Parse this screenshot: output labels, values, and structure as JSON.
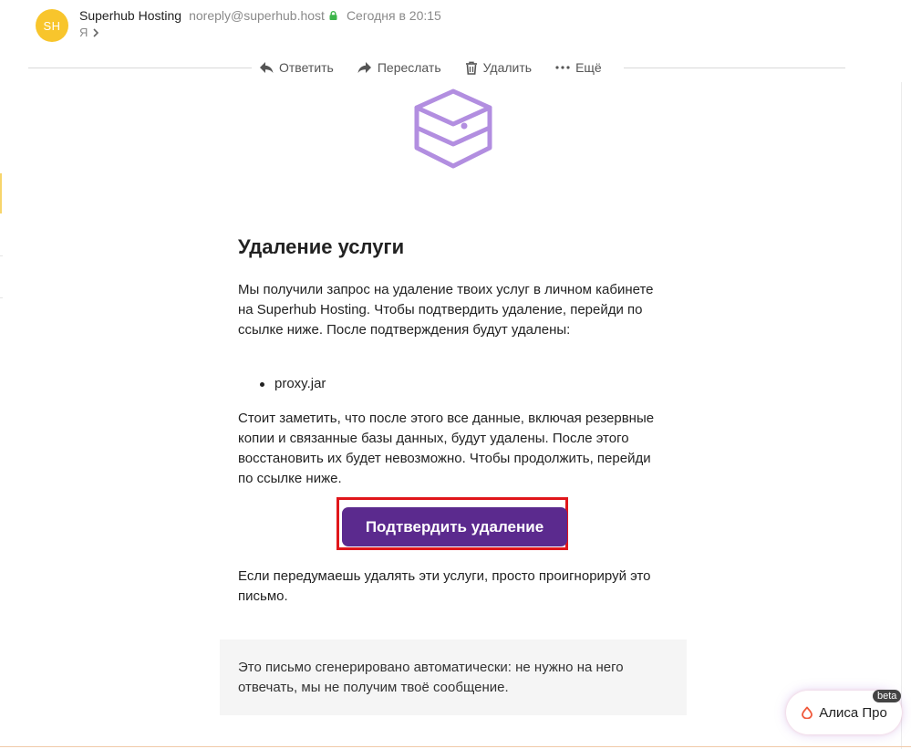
{
  "header": {
    "avatar_initials": "SH",
    "sender_name": "Superhub Hosting",
    "sender_email": "noreply@superhub.host",
    "date": "Сегодня в 20:15",
    "recipient": "Я"
  },
  "toolbar": {
    "reply_label": "Ответить",
    "forward_label": "Переслать",
    "delete_label": "Удалить",
    "more_label": "Ещё"
  },
  "email": {
    "title": "Удаление услуги",
    "paragraph1": "Мы получили запрос на удаление твоих услуг в личном кабинете на Superhub Hosting. Чтобы подтвердить удаление, перейди по ссылке ниже. После подтверждения будут удалены:",
    "services": [
      "proxy.jar"
    ],
    "paragraph2": "Стоит заметить, что после этого все данные, включая резервные копии и связанные базы данных, будут удалены. После этого восстановить их будет невозможно. Чтобы продолжить, перейди по ссылке ниже.",
    "confirm_button": "Подтвердить удаление",
    "paragraph3": "Если передумаешь удалять эти услуги, просто проигнорируй это письмо.",
    "footer_note": "Это письмо сгенерировано автоматически: не нужно на него отвечать, мы не получим твоё сообщение."
  },
  "alice": {
    "label": "Алиса Про",
    "badge": "beta"
  },
  "colors": {
    "avatar": "#f8c52c",
    "lock": "#3cb54a",
    "brand_purple": "#5b2a8e",
    "icon_purple": "#b28ee0",
    "highlight_red": "#e0161b"
  },
  "icons": {
    "lock": "lock-icon",
    "reply": "reply-icon",
    "forward": "forward-icon",
    "delete": "trash-icon",
    "more": "more-dots-icon",
    "box": "box-icon",
    "alice": "alice-icon"
  }
}
